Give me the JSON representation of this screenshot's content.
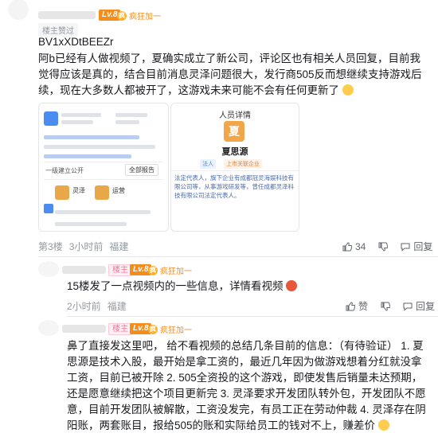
{
  "comment1": {
    "level": "Lv.8",
    "fan_label": "疯狂加一",
    "building_tag": "楼主赞过",
    "title_line": "BV1xXDtBEEZr",
    "text": "阿b已经有人做视频了，夏确实成立了新公司，评论区也有相关人员回复，目前我觉得应该是真的，结合目前消息灵泽问题很大，发行商505反而想继续支持游戏后续，现在大多数人都被开了，这游戏未来可能不会有任何更新了",
    "image2": {
      "header": "人员详情",
      "avatar_char": "夏",
      "name": "夏思源",
      "pill1": "法人",
      "pill2": "上市关联企业",
      "desc": "法定代表人，旗下企业有成都冠灵海娱科技有限公司等，从事游戏研发等，曾任成都灵泽科技有限公司法定代表人。"
    },
    "image1": {
      "company_a": "灵泽",
      "company_b": "运营",
      "row_label": "一级建立公开",
      "btn_label": "全部报告"
    },
    "floor": "第3楼",
    "time": "3小时前",
    "location": "福建",
    "likes": "34",
    "reply": "回复"
  },
  "comment2": {
    "host_tag": "楼主",
    "level": "Lv.8",
    "fan_label": "疯狂加一",
    "text": "15楼发了一点视频内的一些信息，详情看视频",
    "time": "2小时前",
    "location": "福建",
    "like": "赞",
    "reply": "回复"
  },
  "comment3": {
    "host_tag": "楼主",
    "level": "Lv.8",
    "fan_label": "疯狂加一",
    "text": "鼻了直接发这里吧， 给不看视频的总结几条目前的信息：（有待验证） 1. 夏思源是技术入股，最开始是拿工资的，最近几年因为做游戏想着分红就没拿工资，目前已被开除 2. 505全资投的这个游戏，即使发售后销量未达预期，还是愿意继续把这个项目更新完 3. 灵泽要求开发团队转外包，开发团队不愿意，目前开发团队被解散，工资没发完，有员工正在劳动仲裁 4. 灵泽存在阴阳账，两套账目，报给505的账和实际给员工的钱对不上，赚差价"
  }
}
